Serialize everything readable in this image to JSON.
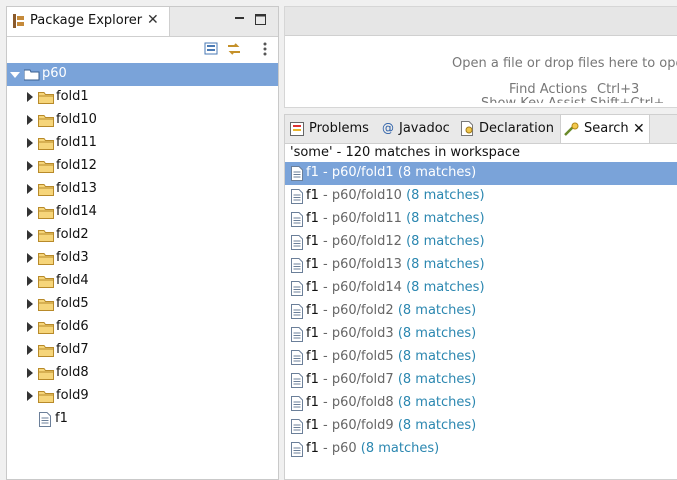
{
  "package_explorer": {
    "tab_label": "Package Explorer",
    "tree": {
      "project": "p60",
      "children": [
        {
          "label": "fold1"
        },
        {
          "label": "fold10"
        },
        {
          "label": "fold11"
        },
        {
          "label": "fold12"
        },
        {
          "label": "fold13"
        },
        {
          "label": "fold14"
        },
        {
          "label": "fold2"
        },
        {
          "label": "fold3"
        },
        {
          "label": "fold4"
        },
        {
          "label": "fold5"
        },
        {
          "label": "fold6"
        },
        {
          "label": "fold7"
        },
        {
          "label": "fold8"
        },
        {
          "label": "fold9"
        }
      ],
      "file": "f1"
    }
  },
  "editor_area": {
    "drop_hint": "Open a file or drop files here to ope",
    "find_actions_label": "Find Actions",
    "find_actions_key": "Ctrl+3",
    "partial_line": "Show Key Assist  Shift+Ctrl+"
  },
  "views": {
    "tabs": [
      {
        "label": "Problems",
        "icon": "problems-icon"
      },
      {
        "label": "Javadoc",
        "icon": "javadoc-icon"
      },
      {
        "label": "Declaration",
        "icon": "declaration-icon"
      },
      {
        "label": "Search",
        "icon": "search-icon",
        "active": true
      }
    ],
    "search": {
      "summary": "'some' - 120 matches in workspace",
      "results": [
        {
          "name": "f1",
          "path": "p60/fold1",
          "matches": "(8 matches)",
          "selected": true
        },
        {
          "name": "f1",
          "path": "p60/fold10",
          "matches": "(8 matches)"
        },
        {
          "name": "f1",
          "path": "p60/fold11",
          "matches": "(8 matches)"
        },
        {
          "name": "f1",
          "path": "p60/fold12",
          "matches": "(8 matches)"
        },
        {
          "name": "f1",
          "path": "p60/fold13",
          "matches": "(8 matches)"
        },
        {
          "name": "f1",
          "path": "p60/fold14",
          "matches": "(8 matches)"
        },
        {
          "name": "f1",
          "path": "p60/fold2",
          "matches": "(8 matches)"
        },
        {
          "name": "f1",
          "path": "p60/fold3",
          "matches": "(8 matches)"
        },
        {
          "name": "f1",
          "path": "p60/fold5",
          "matches": "(8 matches)"
        },
        {
          "name": "f1",
          "path": "p60/fold7",
          "matches": "(8 matches)"
        },
        {
          "name": "f1",
          "path": "p60/fold8",
          "matches": "(8 matches)"
        },
        {
          "name": "f1",
          "path": "p60/fold9",
          "matches": "(8 matches)"
        },
        {
          "name": "f1",
          "path": "p60",
          "matches": "(8 matches)"
        }
      ]
    }
  },
  "colors": {
    "selection": "#7aa3d9",
    "match_count": "#2b87b0",
    "folder": "#e8b04a"
  }
}
